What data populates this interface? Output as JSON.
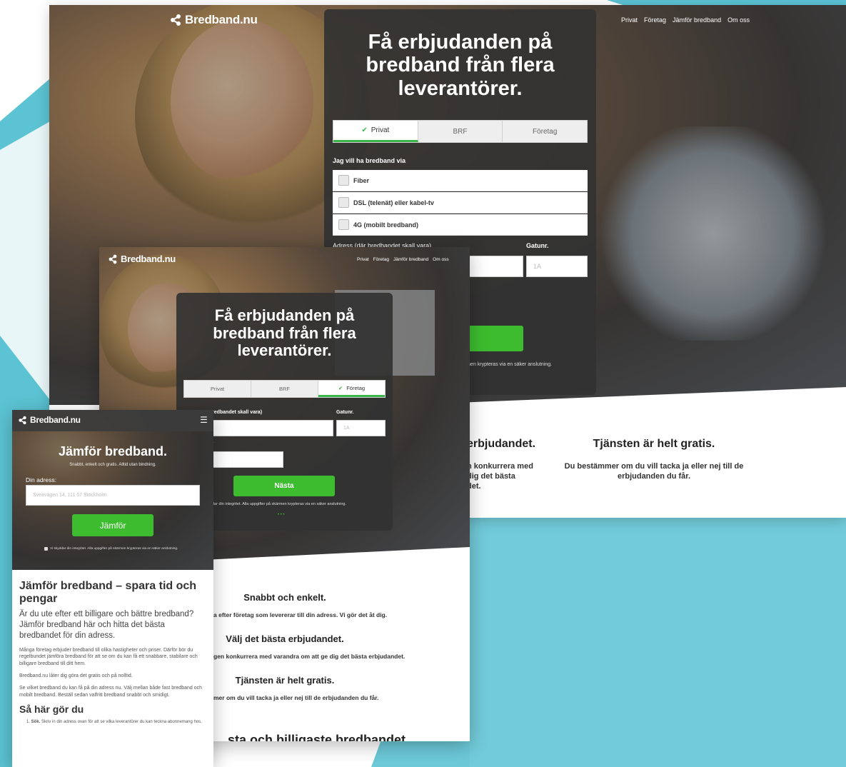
{
  "colors": {
    "teal": "#5bc3d3",
    "green": "#3dbc2f",
    "panel": "#323232"
  },
  "desktop": {
    "logo": "Bredband.nu",
    "nav": [
      "Privat",
      "Företag",
      "Jämför bredband",
      "Om oss"
    ],
    "hero_title": "Få erbjudanden på bredband från flera leverantörer.",
    "tabs": [
      {
        "label": "Privat",
        "active": true
      },
      {
        "label": "BRF"
      },
      {
        "label": "Företag"
      }
    ],
    "connection_label": "Jag vill ha bredband via",
    "options": [
      "Fiber",
      "DSL (telenät) eller kabel-tv",
      "4G (mobilt bredband)"
    ],
    "address_label": "Adress (där bredbandet skall vara)",
    "street_no_label": "Gatunr.",
    "street_no_placeholder": "1A",
    "secure_note_partial": "ärmen krypteras via en säker anslutning.",
    "feature2_title_partial": "erbjudandet.",
    "feature2_text_line1": "n konkurrera med",
    "feature2_text_line2": "dig det bästa",
    "feature2_text_line3": "det.",
    "feature3_title": "Tjänsten är helt gratis.",
    "feature3_text": "Du bestämmer om du vill tacka ja eller nej till de erbjudanden du får."
  },
  "tablet": {
    "logo": "Bredband.nu",
    "nav": [
      "Privat",
      "Företag",
      "Jämför bredband",
      "Om oss"
    ],
    "hero_title": "Få erbjudanden på bredband från flera leverantörer.",
    "tabs": [
      {
        "label": "Privat"
      },
      {
        "label": "BRF"
      },
      {
        "label": "Företag",
        "active": true
      }
    ],
    "address_label_partial": "redbandet skall vara)",
    "street_no_label": "Gatunr.",
    "street_no_placeholder": "1A",
    "field2_label_partial": "r",
    "next_button": "Nästa",
    "secure_note_partial": "dar din integritet. Alla uppgifter på skärmen krypteras via en säker anslutning.",
    "dots": "• • •",
    "feature1_title": "Snabbt och enkelt.",
    "feature1_text": "a efter företag som levererar till din adress. Vi gör det åt dig.",
    "feature2_title": "Välj det bästa erbjudandet.",
    "feature2_text": "gen konkurrera med varandra om att ge dig det bästa erbjudandet.",
    "feature3_title": "Tjänsten är helt gratis.",
    "feature3_text": "mer om du vill tacka ja eller nej till de erbjudanden du får.",
    "bottom_heading_partial": "sta och billigaste bredbandet"
  },
  "mobile": {
    "logo": "Bredband.nu",
    "menu_icon": "☰",
    "hero_title": "Jämför bredband.",
    "hero_sub": "Snabbt, enkelt och gratis. Alltid utan bindning.",
    "address_label": "Din adress:",
    "address_placeholder": "Sveavägen 14, 111 57 Stockholm",
    "compare_button": "Jämför",
    "secure_note": "Vi skyddar din integritet. Alla uppgifter på skärmen krypteras via en säker anslutning.",
    "article_title": "Jämför bredband – spara tid och pengar",
    "lead": "Är du ute efter ett billigare och bättre bredband? Jämför bredband här och hitta det bästa bredbandet för din adress.",
    "p1": "Många företag erbjuder bredband till olika hastigheter och priser. Därför bör du regelbundet jämföra bredband för att se om du kan få ett snabbare, stabilare och billigare bredband till ditt hem.",
    "p2": "Bredband.nu låter dig göra det gratis och på nolltid.",
    "p3": "Se vilket bredband du kan få på din adress nu. Välj mellan både fast bredband och mobilt bredband. Beställ sedan valfritt bredband snabbt och smidigt.",
    "how_title": "Så här gör du",
    "step1_bold": "Sök.",
    "step1_text": "Skriv in din adress ovan för att se vilka leverantörer du kan teckna abonnemang hos."
  }
}
